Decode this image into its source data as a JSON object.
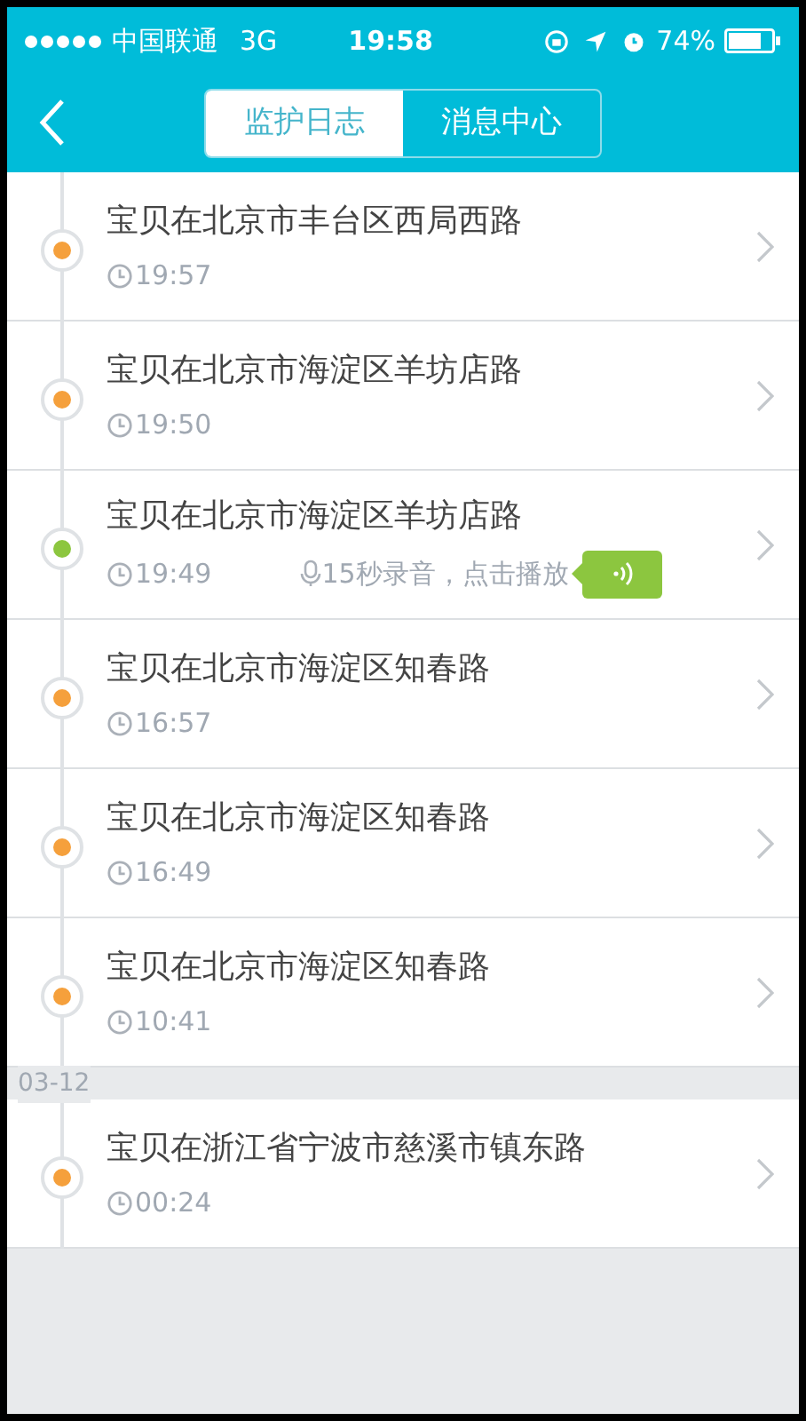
{
  "status_bar": {
    "carrier": "中国联通",
    "network": "3G",
    "time": "19:58",
    "battery": "74%"
  },
  "tabs": [
    {
      "label": "监护日志",
      "selected": true
    },
    {
      "label": "消息中心",
      "selected": false
    }
  ],
  "log": [
    {
      "kind": "entry",
      "title": "宝贝在北京市丰台区西局西路",
      "time": "19:57",
      "color": "#f5a03c"
    },
    {
      "kind": "entry",
      "title": "宝贝在北京市海淀区羊坊店路",
      "time": "19:50",
      "color": "#f5a03c"
    },
    {
      "kind": "entry",
      "title": "宝贝在北京市海淀区羊坊店路",
      "time": "19:49",
      "color": "#8cc63f",
      "voice": "15秒录音，点击播放"
    },
    {
      "kind": "entry",
      "title": "宝贝在北京市海淀区知春路",
      "time": "16:57",
      "color": "#f5a03c"
    },
    {
      "kind": "entry",
      "title": "宝贝在北京市海淀区知春路",
      "time": "16:49",
      "color": "#f5a03c"
    },
    {
      "kind": "entry",
      "title": "宝贝在北京市海淀区知春路",
      "time": "10:41",
      "color": "#f5a03c"
    },
    {
      "kind": "date",
      "label": "03-12"
    },
    {
      "kind": "entry",
      "title": "宝贝在浙江省宁波市慈溪市镇东路",
      "time": "00:24",
      "color": "#f5a03c"
    }
  ]
}
